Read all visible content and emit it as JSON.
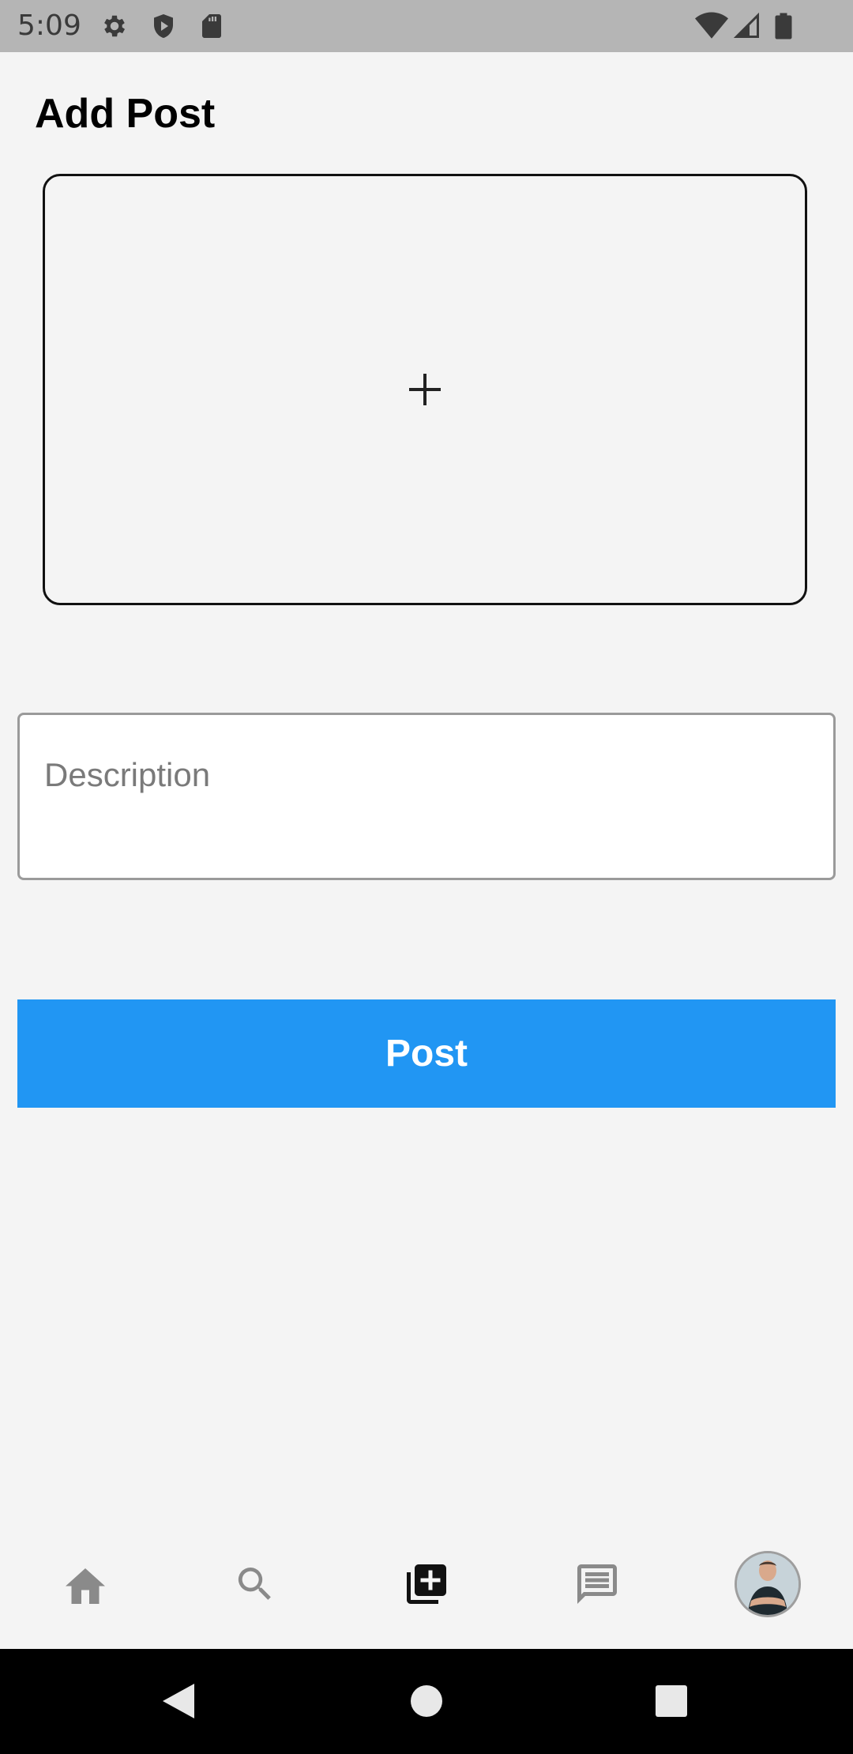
{
  "status_bar": {
    "time": "5:09",
    "left_icons": [
      "gear-icon",
      "shield-play-icon",
      "sd-card-icon"
    ],
    "right_icons": [
      "wifi-icon",
      "signal-icon",
      "battery-icon"
    ]
  },
  "header": {
    "title": "Add Post"
  },
  "image_picker": {
    "icon": "plus-icon"
  },
  "description": {
    "placeholder": "Description",
    "value": ""
  },
  "post_button": {
    "label": "Post",
    "color": "#2196f3"
  },
  "bottom_nav": {
    "items": [
      {
        "icon": "home-icon",
        "active": false
      },
      {
        "icon": "search-icon",
        "active": false
      },
      {
        "icon": "add-post-icon",
        "active": true
      },
      {
        "icon": "message-icon",
        "active": false
      },
      {
        "icon": "avatar",
        "active": false
      }
    ]
  },
  "system_nav": {
    "buttons": [
      "back-icon",
      "home-circle-icon",
      "recents-icon"
    ]
  }
}
